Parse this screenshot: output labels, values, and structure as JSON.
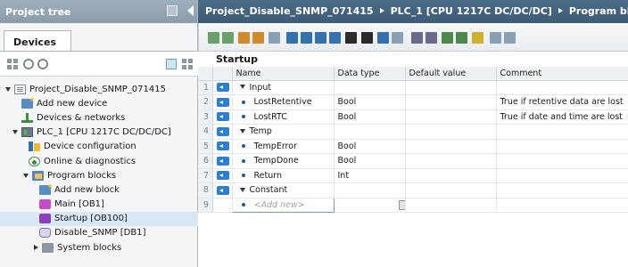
{
  "project_tree": {
    "title": "Project tree",
    "tab": "Devices",
    "items": [
      {
        "label": "Project_Disable_SNMP_071415",
        "icon": "project-icon"
      },
      {
        "label": "Add new device",
        "icon": "add-device-icon"
      },
      {
        "label": "Devices & networks",
        "icon": "network-icon"
      },
      {
        "label": "PLC_1 [CPU 1217C DC/DC/DC]",
        "icon": "plc-icon"
      },
      {
        "label": "Device configuration",
        "icon": "device-config-icon"
      },
      {
        "label": "Online & diagnostics",
        "icon": "diagnostics-icon"
      },
      {
        "label": "Program blocks",
        "icon": "folder-icon"
      },
      {
        "label": "Add new block",
        "icon": "add-block-icon"
      },
      {
        "label": "Main [OB1]",
        "icon": "ob-icon"
      },
      {
        "label": "Startup [OB100]",
        "icon": "ob-icon"
      },
      {
        "label": "Disable_SNMP [DB1]",
        "icon": "db-icon"
      },
      {
        "label": "System blocks",
        "icon": "system-folder-icon"
      }
    ]
  },
  "editor": {
    "breadcrumb": [
      "Project_Disable_SNMP_071415",
      "PLC_1 [CPU 1217C DC/DC/DC]",
      "Program blocks"
    ],
    "block_title": "Startup",
    "columns": [
      "Name",
      "Data type",
      "Default value",
      "Comment"
    ],
    "rows": [
      {
        "num": "1",
        "name": "Input",
        "type": "",
        "default": "",
        "comment": ""
      },
      {
        "num": "2",
        "name": "LostRetentive",
        "type": "Bool",
        "default": "",
        "comment": "True if retentive data are lost"
      },
      {
        "num": "3",
        "name": "LostRTC",
        "type": "Bool",
        "default": "",
        "comment": "True if date and time are lost"
      },
      {
        "num": "4",
        "name": "Temp",
        "type": "",
        "default": "",
        "comment": ""
      },
      {
        "num": "5",
        "name": "TempError",
        "type": "Bool",
        "default": "",
        "comment": ""
      },
      {
        "num": "6",
        "name": "TempDone",
        "type": "Bool",
        "default": "",
        "comment": ""
      },
      {
        "num": "7",
        "name": "Return",
        "type": "Int",
        "default": "",
        "comment": ""
      },
      {
        "num": "8",
        "name": "Constant",
        "type": "",
        "default": "",
        "comment": ""
      },
      {
        "num": "9",
        "name": "<Add new>",
        "type": "",
        "default": "",
        "comment": ""
      }
    ]
  },
  "colors": {
    "left_title_bg": "#8a9ca9",
    "breadcrumb_bg": "#3d5c75",
    "selection": "#d7e7f4",
    "param_icon": "#2a7fd4"
  }
}
